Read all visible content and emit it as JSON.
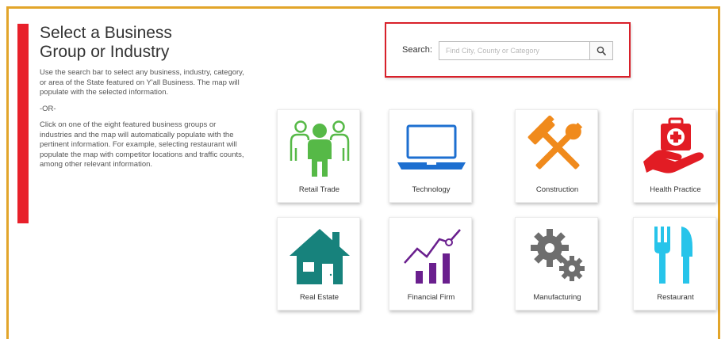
{
  "intro": {
    "title_line1": "Select a Business",
    "title_line2": "Group or Industry",
    "paragraph1": "Use the search bar to select any business, industry, category, or area of the State featured on Y'all Business. The map will populate with the selected information.",
    "or_text": "-OR-",
    "paragraph2": "Click on one of the eight featured business groups or industries and the map will automatically populate with the pertinent information. For example, selecting restaurant will populate the map with competitor locations and traffic counts, among other relevant information."
  },
  "search": {
    "label": "Search:",
    "placeholder": "Find City, County or Category",
    "value": "",
    "button_icon": "magnifier-icon"
  },
  "categories": [
    {
      "label": "Retail Trade",
      "icon": "people-group-icon",
      "color": "#56b947"
    },
    {
      "label": "Technology",
      "icon": "laptop-icon",
      "color": "#1d6fd0"
    },
    {
      "label": "Construction",
      "icon": "hammer-wrench-icon",
      "color": "#f08a1c"
    },
    {
      "label": "Health Practice",
      "icon": "medical-kit-hand-icon",
      "color": "#e21c24"
    },
    {
      "label": "Real Estate",
      "icon": "house-icon",
      "color": "#17827c"
    },
    {
      "label": "Financial Firm",
      "icon": "growth-chart-icon",
      "color": "#6a1f8e"
    },
    {
      "label": "Manufacturing",
      "icon": "gears-icon",
      "color": "#6e6e6e"
    },
    {
      "label": "Restaurant",
      "icon": "fork-knife-icon",
      "color": "#27c4ea"
    }
  ],
  "colors": {
    "accent_red": "#e8202a",
    "frame_gold": "#e2a52a"
  }
}
